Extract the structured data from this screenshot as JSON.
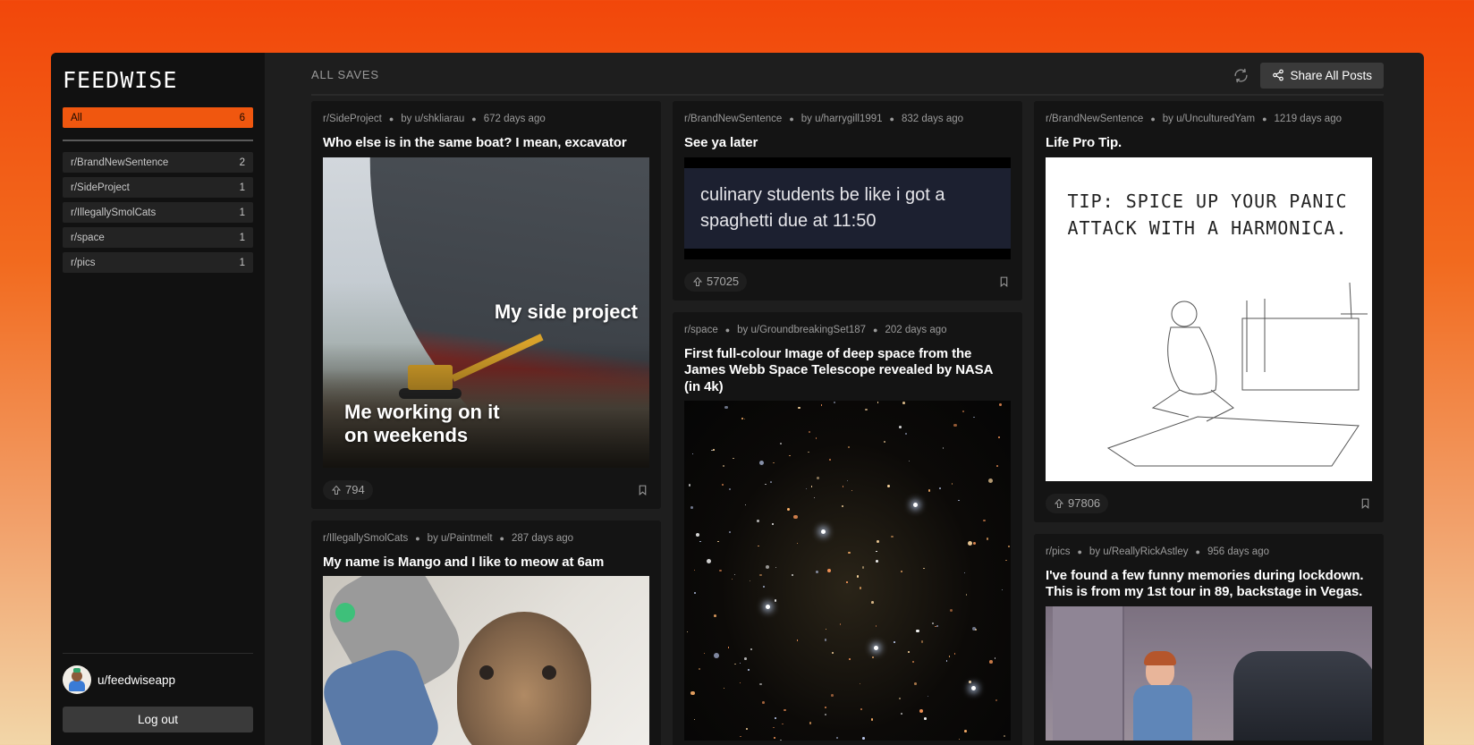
{
  "app": {
    "logo": "FEEDWISE"
  },
  "sidebar": {
    "all": {
      "label": "All",
      "count": "6"
    },
    "items": [
      {
        "label": "r/BrandNewSentence",
        "count": "2"
      },
      {
        "label": "r/SideProject",
        "count": "1"
      },
      {
        "label": "r/IllegallySmolCats",
        "count": "1"
      },
      {
        "label": "r/space",
        "count": "1"
      },
      {
        "label": "r/pics",
        "count": "1"
      }
    ],
    "user": {
      "name": "u/feedwiseapp"
    },
    "logout_label": "Log out"
  },
  "header": {
    "title": "ALL SAVES",
    "share_label": "Share All Posts"
  },
  "posts": [
    {
      "subreddit": "r/SideProject",
      "author": "by u/shkliarau",
      "age": "672 days ago",
      "title": "Who else is in the same boat? I mean, excavator",
      "image_text_1": "My side project",
      "image_text_2": "Me working on it on weekends",
      "upvotes": "794"
    },
    {
      "subreddit": "r/BrandNewSentence",
      "author": "by u/harrygill1991",
      "age": "832 days ago",
      "title": "See ya later",
      "image_text": "culinary students be like i got a spaghetti due at 11:50",
      "upvotes": "57025"
    },
    {
      "subreddit": "r/BrandNewSentence",
      "author": "by u/UnculturedYam",
      "age": "1219 days ago",
      "title": "Life Pro Tip.",
      "image_text": "TIP: SPICE UP YOUR PANIC ATTACK WITH A HARMONICA.",
      "upvotes": "97806"
    },
    {
      "subreddit": "r/IllegallySmolCats",
      "author": "by u/Paintmelt",
      "age": "287 days ago",
      "title": "My name is Mango and I like to meow at 6am"
    },
    {
      "subreddit": "r/space",
      "author": "by u/GroundbreakingSet187",
      "age": "202 days ago",
      "title": "First full-colour Image of deep space from the James Webb Space Telescope revealed by NASA (in 4k)"
    },
    {
      "subreddit": "r/pics",
      "author": "by u/ReallyRickAstley",
      "age": "956 days ago",
      "title": "I've found a few funny memories during lockdown. This is from my 1st tour in 89, backstage in Vegas."
    }
  ],
  "colors": {
    "accent": "#f0570f",
    "sidebar_bg": "#111111",
    "main_bg": "#1e1e1e",
    "card_bg": "#141414"
  },
  "icons": {
    "refresh": "refresh-icon",
    "share": "share-icon",
    "upvote": "upvote-icon",
    "bookmark": "bookmark-icon"
  }
}
